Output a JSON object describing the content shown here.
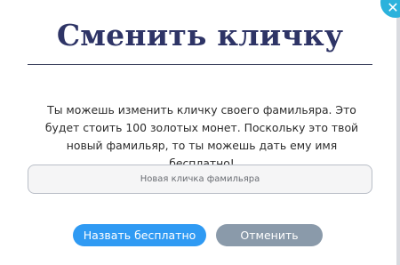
{
  "dialog": {
    "title": "Сменить кличку",
    "description": "Ты можешь изменить кличку своего фамильяра. Это будет стоить 100 золотых монет. Поскольку это твой новый фамильяр, то ты можешь дать ему имя бесплатно!",
    "input": {
      "placeholder": "Новая кличка фамильяра",
      "value": ""
    },
    "buttons": {
      "rename_free": "Назвать бесплатно",
      "cancel": "Отменить"
    },
    "close_icon": "close-icon"
  },
  "colors": {
    "title": "#2e3466",
    "primary_button": "#2f9af3",
    "secondary_button": "#8a9aaa",
    "close_button": "#2bb2dc"
  }
}
